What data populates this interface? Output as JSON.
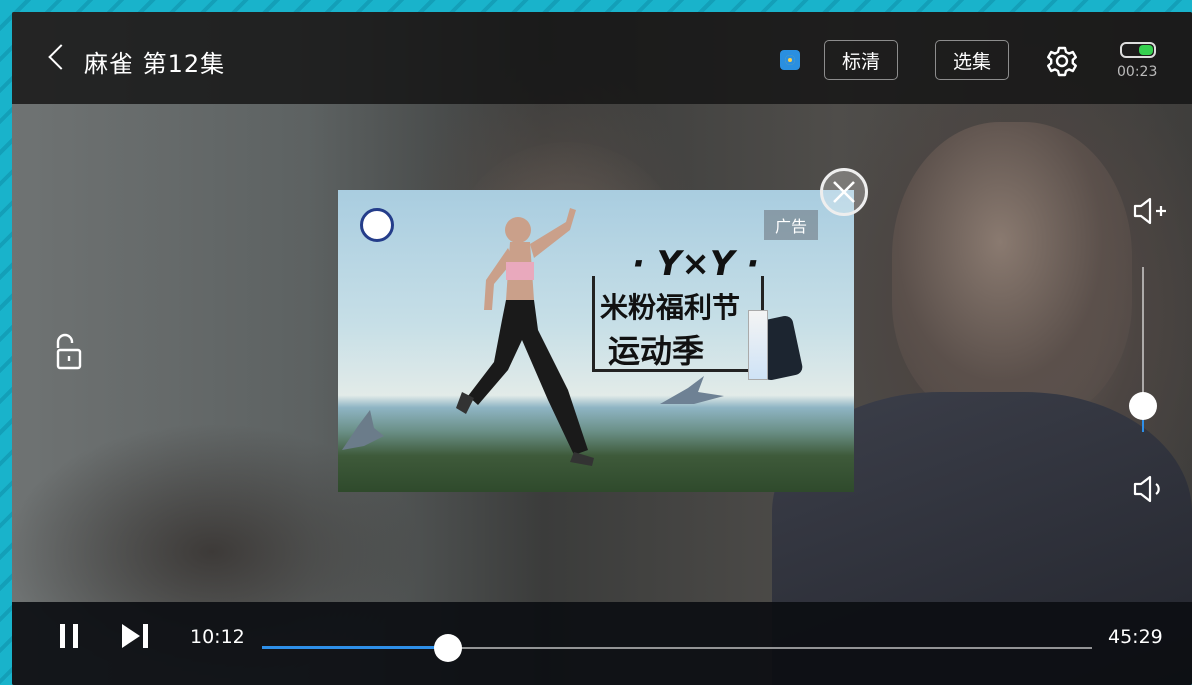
{
  "topbar": {
    "title": "麻雀 第12集",
    "quality_label": "标清",
    "episodes_label": "选集",
    "clock": "00:23",
    "battery_level": 0.5,
    "app_icon": "tv-cast-icon"
  },
  "ad": {
    "badge": "广告",
    "kicker": "· Y×Y ·",
    "headline_line1": "米粉福利节",
    "headline_line2": "运动季",
    "close_icon": "close-circle-icon"
  },
  "playback": {
    "current_time": "10:12",
    "duration": "45:29",
    "progress": 0.2244,
    "state_icon": "pause-icon",
    "next_icon": "next-episode-icon"
  },
  "volume": {
    "level": 0.16,
    "up_icon": "volume-up-icon",
    "down_icon": "volume-down-icon"
  },
  "side": {
    "lock_icon": "unlock-icon"
  },
  "colors": {
    "accent": "#2e8fe8",
    "bar_bg": "#141414",
    "battery": "#35d04f"
  }
}
